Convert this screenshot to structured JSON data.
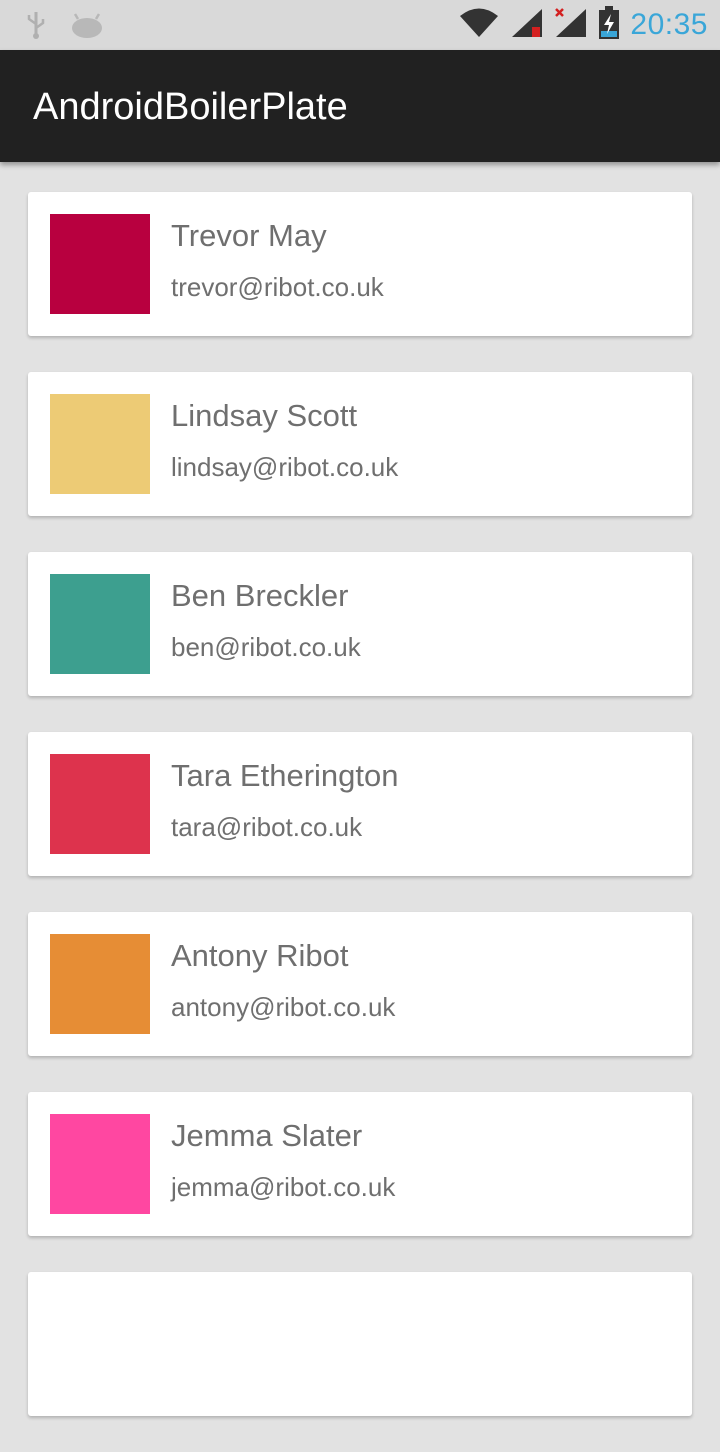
{
  "status_bar": {
    "time": "20:35",
    "icons": [
      "usb-icon",
      "android-debug-icon",
      "wifi-icon",
      "signal-icon",
      "signal-icon",
      "battery-charging-icon"
    ]
  },
  "app_bar": {
    "title": "AndroidBoilerPlate"
  },
  "users": [
    {
      "name": "Trevor May",
      "email": "trevor@ribot.co.uk",
      "color": "#b8003f"
    },
    {
      "name": "Lindsay Scott",
      "email": "lindsay@ribot.co.uk",
      "color": "#edcb75"
    },
    {
      "name": "Ben Breckler",
      "email": "ben@ribot.co.uk",
      "color": "#3d9f8f"
    },
    {
      "name": "Tara Etherington",
      "email": "tara@ribot.co.uk",
      "color": "#dd334d"
    },
    {
      "name": "Antony Ribot",
      "email": "antony@ribot.co.uk",
      "color": "#e68d35"
    },
    {
      "name": "Jemma Slater",
      "email": "jemma@ribot.co.uk",
      "color": "#ff47a1"
    },
    {
      "name": "",
      "email": "",
      "color": "#ffffff"
    }
  ]
}
